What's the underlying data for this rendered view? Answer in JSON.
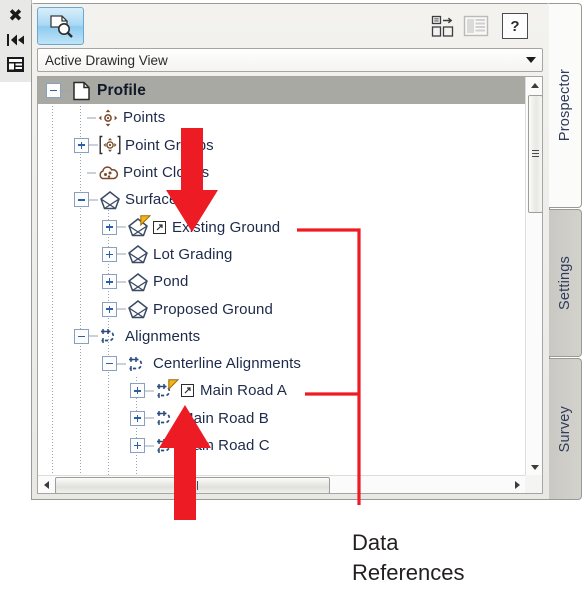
{
  "window": {
    "title": "Prospector",
    "left_toolbar": [
      {
        "name": "close-icon",
        "glyph": "✖",
        "label": "Close"
      },
      {
        "name": "auto-hide-icon",
        "glyph": "auto-hide",
        "label": "Auto-hide"
      },
      {
        "name": "properties-menu-icon",
        "glyph": "properties",
        "label": "Properties"
      }
    ]
  },
  "toolbar": {
    "view_button_label": "Prospector View",
    "panorama_label": "Panorama",
    "item_view_label": "Item View",
    "help_label": "?"
  },
  "view_combo": {
    "value": "Active Drawing View",
    "placeholder": "Active Drawing View",
    "arrow_icon": "chevron-down-icon"
  },
  "tree": {
    "items": [
      {
        "label": "Profile",
        "depth": 0,
        "icon": "drawing-icon",
        "expander": "minus",
        "selected": true,
        "flag": false,
        "dref": false
      },
      {
        "label": "Points",
        "depth": 1,
        "icon": "points-icon",
        "expander": "none",
        "selected": false,
        "flag": false,
        "dref": false
      },
      {
        "label": "Point Groups",
        "depth": 1,
        "icon": "point-groups-icon",
        "expander": "plus",
        "selected": false,
        "flag": false,
        "dref": false
      },
      {
        "label": "Point Clouds",
        "depth": 1,
        "icon": "point-clouds-icon",
        "expander": "none",
        "selected": false,
        "flag": false,
        "dref": false
      },
      {
        "label": "Surfaces",
        "depth": 1,
        "icon": "surface-icon",
        "expander": "minus",
        "selected": false,
        "flag": false,
        "dref": false
      },
      {
        "label": "Existing Ground",
        "depth": 2,
        "icon": "surface-icon",
        "expander": "plus",
        "selected": false,
        "flag": true,
        "dref": true
      },
      {
        "label": "Lot Grading",
        "depth": 2,
        "icon": "surface-icon",
        "expander": "plus",
        "selected": false,
        "flag": false,
        "dref": false
      },
      {
        "label": "Pond",
        "depth": 2,
        "icon": "surface-icon",
        "expander": "plus",
        "selected": false,
        "flag": false,
        "dref": false
      },
      {
        "label": "Proposed Ground",
        "depth": 2,
        "icon": "surface-icon",
        "expander": "plus",
        "selected": false,
        "flag": false,
        "dref": false
      },
      {
        "label": "Alignments",
        "depth": 1,
        "icon": "alignment-icon",
        "expander": "minus",
        "selected": false,
        "flag": false,
        "dref": false
      },
      {
        "label": "Centerline Alignments",
        "depth": 2,
        "icon": "alignment-icon",
        "expander": "minus",
        "selected": false,
        "flag": false,
        "dref": false
      },
      {
        "label": "Main Road A",
        "depth": 3,
        "icon": "alignment-icon",
        "expander": "plus",
        "selected": false,
        "flag": true,
        "dref": true
      },
      {
        "label": "Main Road B",
        "depth": 3,
        "icon": "alignment-icon",
        "expander": "plus",
        "selected": false,
        "flag": false,
        "dref": false
      },
      {
        "label": "Main Road C",
        "depth": 3,
        "icon": "alignment-icon",
        "expander": "plus",
        "selected": false,
        "flag": false,
        "dref": false
      }
    ]
  },
  "tabs": [
    {
      "label": "Prospector",
      "active": true
    },
    {
      "label": "Settings",
      "active": false
    },
    {
      "label": "Survey",
      "active": false
    }
  ],
  "annotation": {
    "caption_line1": "Data",
    "caption_line2": "References",
    "color": "#ed1c24",
    "arrow_down_target": "existing-ground-data-reference-badge",
    "arrow_up_target": "main-road-a-data-reference-badge"
  },
  "colors": {
    "accent_red": "#ed1c24",
    "flag_yellow": "#f5b21a",
    "tree_text": "#1d2a4a",
    "selection": "#a9a9a4"
  }
}
